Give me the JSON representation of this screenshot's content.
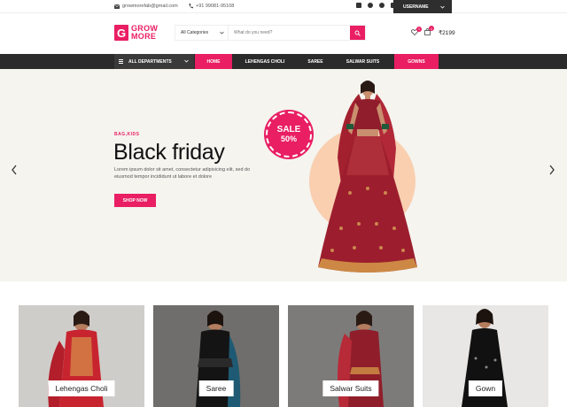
{
  "topbar": {
    "email": "growmorefab@gmail.com",
    "phone": "+91 99081-95108",
    "social_icons": [
      "facebook-icon",
      "instagram-icon",
      "whatsapp-icon",
      "twitter-icon"
    ],
    "username": "USERNAME"
  },
  "header": {
    "logo_letter": "G",
    "logo_line1": "GROW",
    "logo_line2": "MORE",
    "category_select": "All Categories",
    "search_placeholder": "What do you need?",
    "wishlist_count": "1",
    "cart_count": "1",
    "cart_total": "₹2199"
  },
  "nav": {
    "departments_label": "ALL DEPARTMENTS",
    "links": [
      {
        "label": "HOME",
        "active": true
      },
      {
        "label": "LEHENGAS CHOLI",
        "active": false
      },
      {
        "label": "SAREE",
        "active": false
      },
      {
        "label": "SALWAR SUITS",
        "active": false
      },
      {
        "label": "GOWNS",
        "active": true
      }
    ]
  },
  "hero": {
    "eyebrow": "BAG,KIDS",
    "title": "Black friday",
    "description": "Lorem ipsum dolor sit amet, consectetur adipisicing elit, sed do eiusmod tempor incididunt ut labore et dolore",
    "button": "SHOP NOW",
    "sale_line1": "SALE",
    "sale_line2": "50%"
  },
  "categories": [
    {
      "label": "Lehengas Choli"
    },
    {
      "label": "Saree"
    },
    {
      "label": "Salwar Suits"
    },
    {
      "label": "Gown"
    }
  ],
  "colors": {
    "accent": "#e91e63",
    "dark_nav": "#2b2b2b",
    "hero_bg": "#f5f4ef"
  }
}
